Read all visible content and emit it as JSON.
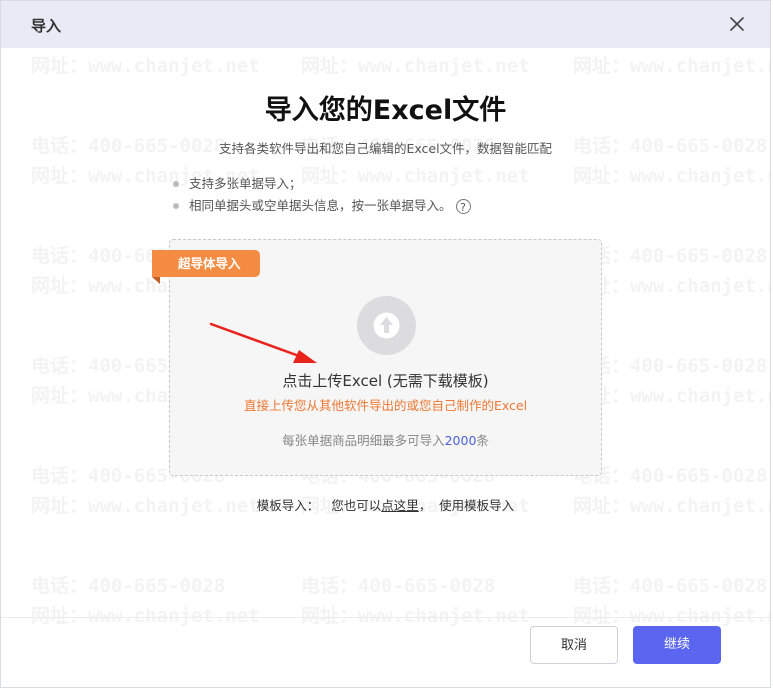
{
  "header": {
    "title": "导入"
  },
  "main": {
    "title": "导入您的Excel文件",
    "subtitle": "支持各类软件导出和您自己编辑的Excel文件，数据智能匹配",
    "bullets": [
      "支持多张单据导入；",
      "相同单据头或空单据头信息，按一张单据导入。"
    ],
    "help_icon_glyph": "?"
  },
  "upload": {
    "badge": "超导体导入",
    "title": "点击上传Excel (无需下载模板)",
    "hint": "直接上传您从其他软件导出的或您自己制作的Excel",
    "limit_prefix": "每张单据商品明细最多可导入",
    "limit_value": "2000",
    "limit_suffix": "条"
  },
  "template": {
    "prefix": "模板导入：   您也可以",
    "link": "点这里",
    "suffix": "，  使用模板导入"
  },
  "footer": {
    "cancel_label": "取消",
    "continue_label": "继续"
  },
  "watermark": {
    "phone": "电话：400-665-0028",
    "site": "网址：www.chanjet.net"
  },
  "colors": {
    "accent": "#5b66f0",
    "badge": "#f58c43",
    "hint": "#ee7833",
    "header_bg": "#e8eaf5",
    "arrow": "#e8231b"
  },
  "icons": {
    "close": "close-icon",
    "upload": "upload-arrow-icon",
    "help": "help-circle-icon"
  }
}
